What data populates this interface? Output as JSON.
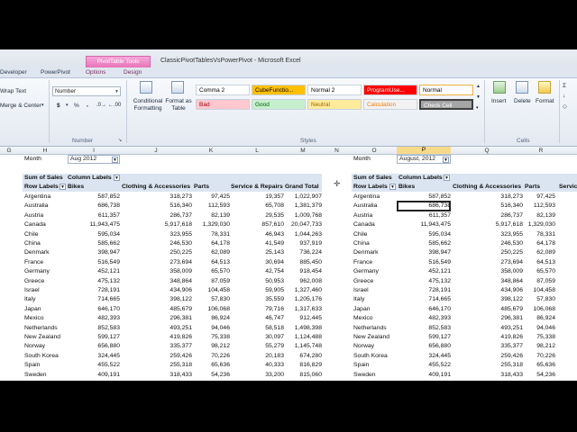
{
  "title_bar": {
    "context_tab": "PivotTable Tools",
    "window_title": "ClassicPivotTablesVsPowerPivot - Microsoft Excel"
  },
  "tabs": [
    "Developer",
    "PowerPivot",
    "Options",
    "Design"
  ],
  "ribbon": {
    "wrap_text": "Wrap Text",
    "merge_center": "Merge & Center",
    "number_format": "Number",
    "number_group": "Number",
    "currency_symbol": "$",
    "percent_symbol": "%",
    "comma_symbol": ",",
    "conditional_formatting": "Conditional Formatting",
    "format_as_table": "Format as Table",
    "styles_group": "Styles",
    "styles": [
      {
        "label": "Comma 2",
        "bg": "#ffffff",
        "fg": "#000000"
      },
      {
        "label": "CubeFunctio...",
        "bg": "#ffc000",
        "fg": "#000000"
      },
      {
        "label": "Normal 2",
        "bg": "#ffffff",
        "fg": "#000000"
      },
      {
        "label": "ProgramUse...",
        "bg": "#ff0000",
        "fg": "#ffffff"
      },
      {
        "label": "Normal",
        "bg": "#ffffff",
        "fg": "#000000"
      },
      {
        "label": "Bad",
        "bg": "#ffc7ce",
        "fg": "#9c0006"
      },
      {
        "label": "Good",
        "bg": "#c6efce",
        "fg": "#006100"
      },
      {
        "label": "Neutral",
        "bg": "#ffeb9c",
        "fg": "#9c6500"
      },
      {
        "label": "Calculation",
        "bg": "#f2f2f2",
        "fg": "#fa7d00"
      },
      {
        "label": "Check Cell",
        "bg": "#a5a5a5",
        "fg": "#ffffff"
      }
    ],
    "insert": "Insert",
    "delete": "Delete",
    "format": "Format",
    "cells_group": "Cells"
  },
  "columns": [
    "G",
    "H",
    "I",
    "J",
    "K",
    "L",
    "M",
    "N",
    "O",
    "P",
    "Q",
    "R"
  ],
  "left_pivot": {
    "filter_label": "Month",
    "filter_value": "Aug 2012",
    "sum_label": "Sum of Sales",
    "column_labels": "Column Labels",
    "row_labels": "Row Labels",
    "headers": [
      "Bikes",
      "Clothing & Accessories",
      "Parts",
      "Service & Repairs",
      "Grand Total"
    ],
    "rows": [
      [
        "Argentina",
        "587,852",
        "318,273",
        "97,425",
        "19,357",
        "1,022,907"
      ],
      [
        "Australia",
        "686,738",
        "516,340",
        "112,593",
        "65,708",
        "1,381,379"
      ],
      [
        "Austria",
        "611,357",
        "286,737",
        "82,139",
        "29,535",
        "1,009,768"
      ],
      [
        "Canada",
        "11,943,475",
        "5,917,618",
        "1,329,030",
        "857,610",
        "20,047,733"
      ],
      [
        "Chile",
        "595,034",
        "323,955",
        "78,331",
        "46,943",
        "1,044,263"
      ],
      [
        "China",
        "585,662",
        "246,530",
        "64,178",
        "41,549",
        "937,919"
      ],
      [
        "Denmark",
        "398,947",
        "250,225",
        "62,089",
        "25,143",
        "736,224"
      ],
      [
        "France",
        "516,549",
        "273,694",
        "64,513",
        "30,694",
        "885,450"
      ],
      [
        "Germany",
        "452,121",
        "358,009",
        "65,570",
        "42,754",
        "918,454"
      ],
      [
        "Greece",
        "475,132",
        "348,864",
        "87,059",
        "50,953",
        "962,008"
      ],
      [
        "Israel",
        "728,191",
        "434,906",
        "104,458",
        "59,905",
        "1,327,460"
      ],
      [
        "Italy",
        "714,665",
        "398,122",
        "57,830",
        "35,559",
        "1,205,176"
      ],
      [
        "Japan",
        "646,170",
        "485,679",
        "106,068",
        "79,716",
        "1,317,633"
      ],
      [
        "Mexico",
        "482,393",
        "296,381",
        "86,924",
        "46,747",
        "912,445"
      ],
      [
        "Netherlands",
        "852,583",
        "493,251",
        "94,046",
        "58,518",
        "1,498,398"
      ],
      [
        "New Zealand",
        "599,127",
        "419,826",
        "75,338",
        "30,097",
        "1,124,488"
      ],
      [
        "Norway",
        "656,880",
        "335,377",
        "98,212",
        "55,279",
        "1,145,748"
      ],
      [
        "South Korea",
        "324,445",
        "259,426",
        "70,226",
        "20,183",
        "674,280"
      ],
      [
        "Spain",
        "455,522",
        "255,318",
        "65,636",
        "40,333",
        "816,829"
      ],
      [
        "Sweden",
        "409,191",
        "318,433",
        "54,236",
        "33,200",
        "815,060"
      ]
    ]
  },
  "right_pivot": {
    "filter_label": "Month",
    "filter_value": "August, 2012",
    "sum_label": "Sum of Sales",
    "column_labels": "Column Labels",
    "row_labels": "Row Labels",
    "headers": [
      "Bikes",
      "Clothing & Accessories",
      "Parts",
      "Service"
    ],
    "rows": [
      [
        "Argentina",
        "587,852",
        "318,273",
        "97,425"
      ],
      [
        "Australia",
        "686,738",
        "516,340",
        "112,593"
      ],
      [
        "Austria",
        "611,357",
        "286,737",
        "82,139"
      ],
      [
        "Canada",
        "11,943,475",
        "5,917,618",
        "1,329,030"
      ],
      [
        "Chile",
        "595,034",
        "323,955",
        "78,331"
      ],
      [
        "China",
        "585,662",
        "246,530",
        "64,178"
      ],
      [
        "Denmark",
        "398,947",
        "250,225",
        "62,089"
      ],
      [
        "France",
        "516,549",
        "273,694",
        "64,513"
      ],
      [
        "Germany",
        "452,121",
        "358,009",
        "65,570"
      ],
      [
        "Greece",
        "475,132",
        "348,864",
        "87,059"
      ],
      [
        "Israel",
        "728,191",
        "434,906",
        "104,458"
      ],
      [
        "Italy",
        "714,665",
        "398,122",
        "57,830"
      ],
      [
        "Japan",
        "646,170",
        "485,679",
        "106,068"
      ],
      [
        "Mexico",
        "482,393",
        "296,381",
        "86,924"
      ],
      [
        "Netherlands",
        "852,583",
        "493,251",
        "94,046"
      ],
      [
        "New Zealand",
        "599,127",
        "419,826",
        "75,338"
      ],
      [
        "Norway",
        "656,880",
        "335,377",
        "98,212"
      ],
      [
        "South Korea",
        "324,445",
        "259,426",
        "70,226"
      ],
      [
        "Spain",
        "455,522",
        "255,318",
        "65,636"
      ],
      [
        "Sweden",
        "409,191",
        "318,433",
        "54,236"
      ]
    ]
  }
}
